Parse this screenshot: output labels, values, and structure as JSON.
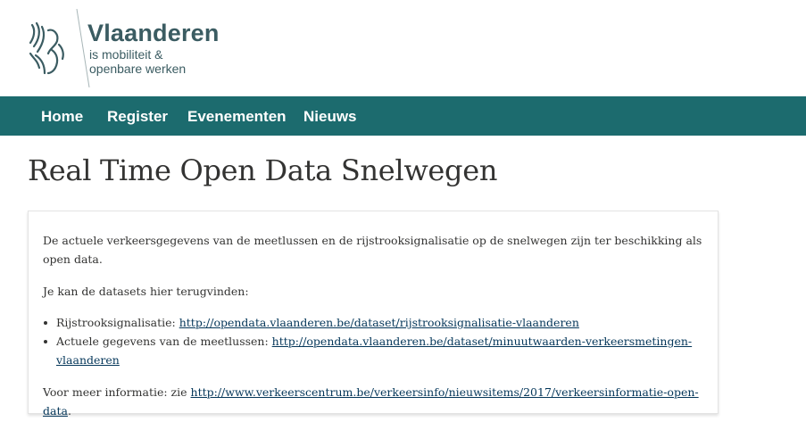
{
  "brand": {
    "name": "Vlaanderen",
    "subtitle_line1": "is mobiliteit &",
    "subtitle_line2": "openbare werken",
    "color": "#3b5c62"
  },
  "nav": {
    "color": "#1c6b6e",
    "items": [
      {
        "label": "Home"
      },
      {
        "label": "Register"
      },
      {
        "label": "Evenementen"
      },
      {
        "label": "Nieuws"
      }
    ]
  },
  "page": {
    "title": "Real Time Open Data Snelwegen"
  },
  "content": {
    "intro": "De actuele verkeersgegevens van de meetlussen en de rijstrooksignalisatie op de snelwegen zijn ter beschikking als open data.",
    "datasets_intro": "Je kan de datasets hier terugvinden:",
    "datasets": [
      {
        "label": "Rijstrooksignalisatie: ",
        "url": "http://opendata.vlaanderen.be/dataset/rijstrooksignalisatie-vlaanderen"
      },
      {
        "label": "Actuele gegevens van de meetlussen: ",
        "url": "http://opendata.vlaanderen.be/dataset/minuutwaarden-verkeersmetingen-vlaanderen"
      }
    ],
    "more_info_label": "Voor meer informatie: zie ",
    "more_info_url": "http://www.verkeerscentrum.be/verkeersinfo/nieuwsitems/2017/verkeersinformatie-open-data",
    "more_info_suffix": ".",
    "link_color": "#05375a"
  }
}
